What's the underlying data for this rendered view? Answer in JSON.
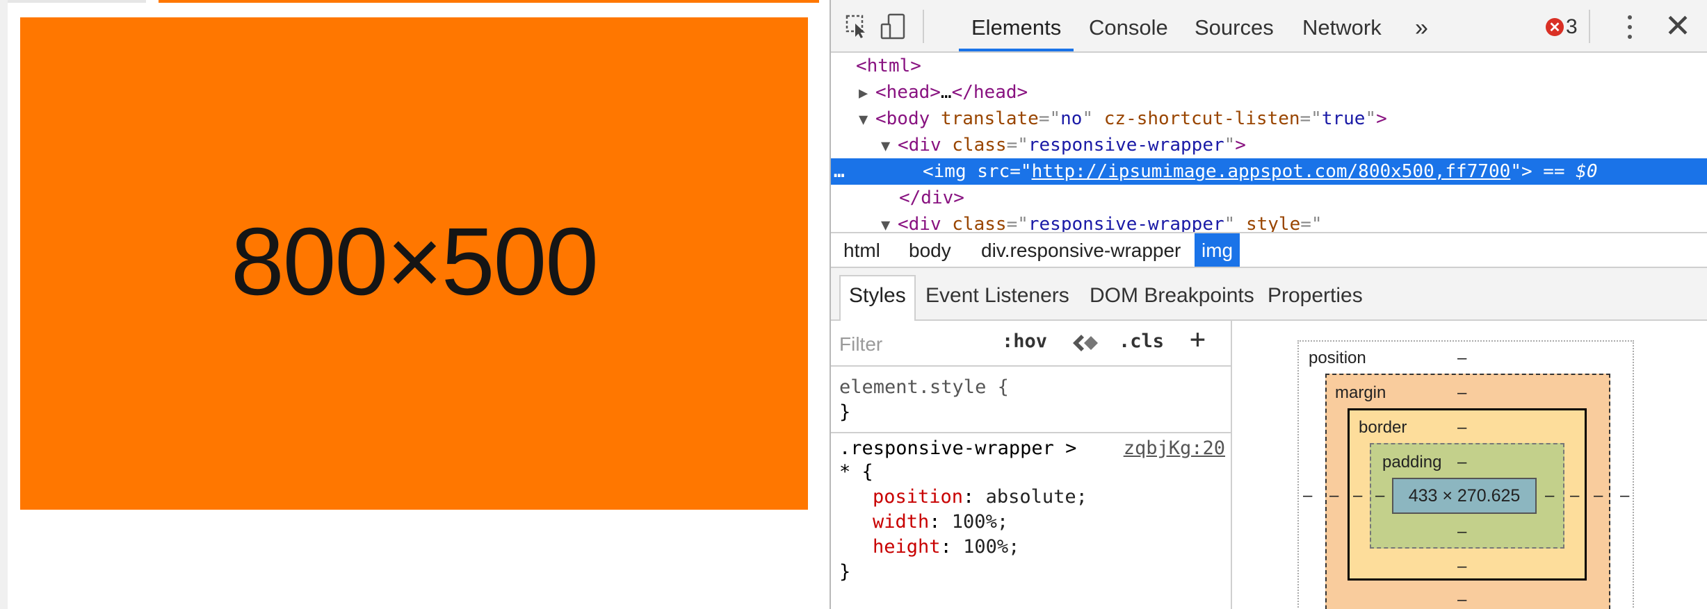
{
  "page": {
    "image_caption": "800×500",
    "image_color": "#ff7700"
  },
  "devtools": {
    "toolbar": {
      "inspect_icon": "inspect-element-icon",
      "device_icon": "device-toolbar-icon",
      "tabs": [
        "Elements",
        "Console",
        "Sources",
        "Network"
      ],
      "more_tabs": "»",
      "error_count": "3",
      "close": "✕"
    },
    "dom": {
      "l1_tag": "<html>",
      "l2_open": "<head>",
      "l2_ellipsis": "…",
      "l2_close": "</head>",
      "l3_tag": "<body",
      "l3_attr1": "translate",
      "l3_val1": "no",
      "l3_attr2": "cz-shortcut-listen",
      "l3_val2": "true",
      "l4_tag": "<div",
      "l4_attr": "class",
      "l4_val": "responsive-wrapper",
      "l5_dots": "…",
      "l5_tag": "<img",
      "l5_attr": "src",
      "l5_val": "http://ipsumimage.appspot.com/800x500,ff7700",
      "l5_eq": "== $0",
      "l6_tag": "</div>",
      "l7_tag": "<div",
      "l7_attr1": "class",
      "l7_val1": "responsive-wrapper",
      "l7_attr2": "style"
    },
    "breadcrumb": [
      "html",
      "body",
      "div.responsive-wrapper",
      "img"
    ],
    "panel_tabs": [
      "Styles",
      "Event Listeners",
      "DOM Breakpoints",
      "Properties"
    ],
    "styles": {
      "filter_placeholder": "Filter",
      "hov": ":hov",
      "cls": ".cls",
      "add": "+",
      "element_style_open": "element.style {",
      "close_brace": "}",
      "rule_selector_1": ".responsive-wrapper >",
      "rule_selector_2": "* {",
      "rule_source": "zqbjKg:20",
      "props": [
        {
          "name": "position",
          "value": "absolute;"
        },
        {
          "name": "width",
          "value": "100%;"
        },
        {
          "name": "height",
          "value": "100%;"
        }
      ]
    },
    "box_model": {
      "position_label": "position",
      "margin_label": "margin",
      "border_label": "border",
      "padding_label": "padding",
      "dash": "–",
      "content_size": "433 × 270.625"
    }
  }
}
